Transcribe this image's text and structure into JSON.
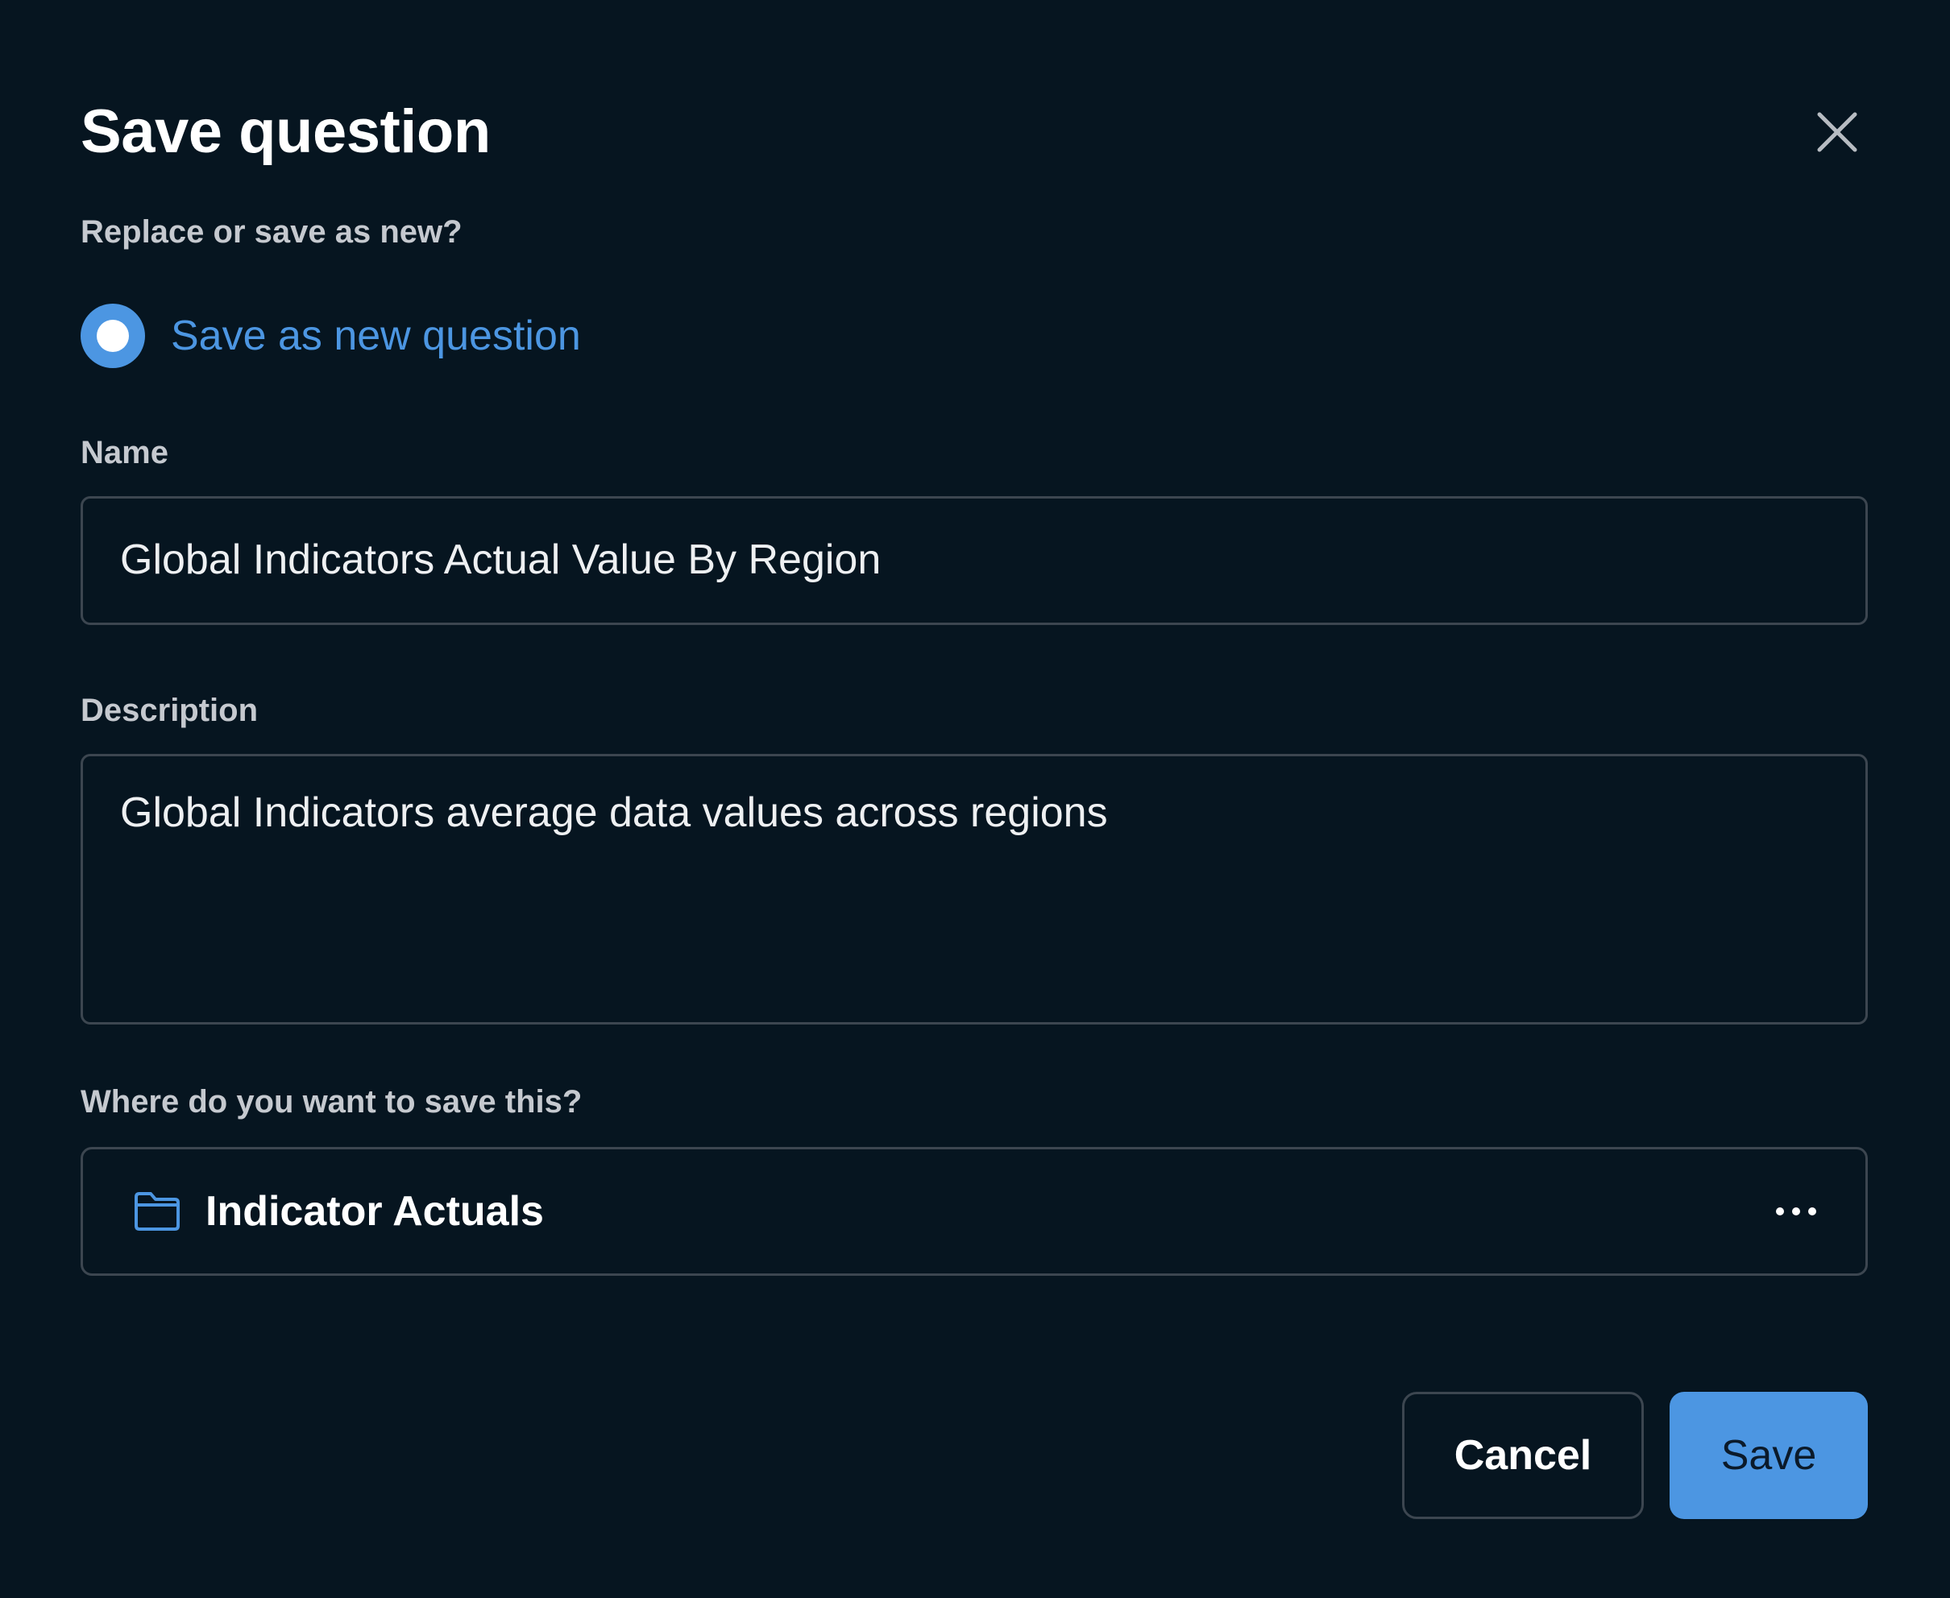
{
  "dialog": {
    "title": "Save question",
    "close_icon": "close-icon"
  },
  "replace_or_new": {
    "label": "Replace or save as new?",
    "options": [
      {
        "label": "Save as new question",
        "selected": true
      }
    ]
  },
  "name_field": {
    "label": "Name",
    "value": "Global Indicators Actual Value By Region"
  },
  "description_field": {
    "label": "Description",
    "value": "Global Indicators average data values across regions"
  },
  "location": {
    "label": "Where do you want to save this?",
    "collection": "Indicator Actuals",
    "icon": "folder-icon",
    "more_icon": "ellipsis-icon"
  },
  "actions": {
    "cancel_label": "Cancel",
    "save_label": "Save"
  },
  "colors": {
    "background": "#061520",
    "accent": "#4c96e2",
    "border": "#3c4650",
    "label": "#c5c9cf",
    "text": "#ffffff"
  }
}
